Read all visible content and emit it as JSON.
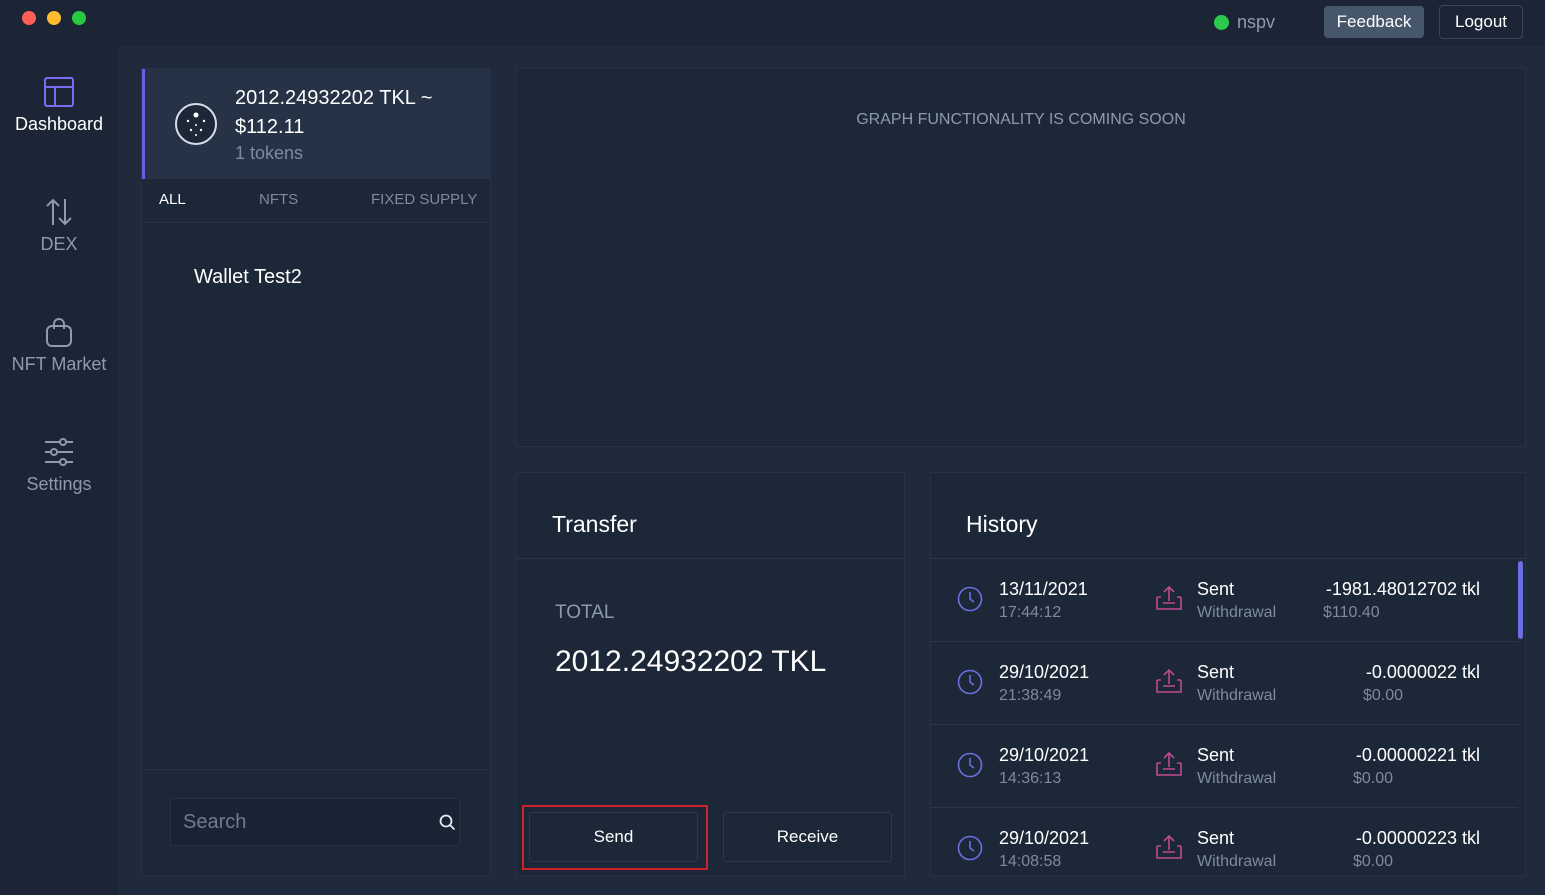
{
  "status": {
    "indicator_color": "#2bc94c",
    "label": "nspv"
  },
  "header": {
    "feedback_label": "Feedback",
    "logout_label": "Logout"
  },
  "sidebar": {
    "items": [
      {
        "label": "Dashboard",
        "icon": "dashboard-icon",
        "active": true
      },
      {
        "label": "DEX",
        "icon": "swap-arrows-icon",
        "active": false
      },
      {
        "label": "NFT Market",
        "icon": "shopping-bag-icon",
        "active": false
      },
      {
        "label": "Settings",
        "icon": "sliders-icon",
        "active": false
      }
    ]
  },
  "wallet": {
    "token_amount": "2012.24932202 TKL ~ $112.11",
    "token_count": "1 tokens",
    "tabs": [
      "ALL",
      "NFTS",
      "FIXED SUPPLY"
    ],
    "active_tab": "ALL",
    "wallet_name": "Wallet Test2",
    "search_placeholder": "Search"
  },
  "graph": {
    "message": "GRAPH FUNCTIONALITY IS COMING SOON"
  },
  "transfer": {
    "title": "Transfer",
    "total_label": "TOTAL",
    "total_value": "2012.24932202 TKL",
    "send_label": "Send",
    "receive_label": "Receive",
    "highlight_color": "#d0202a"
  },
  "history": {
    "title": "History",
    "rows": [
      {
        "date": "13/11/2021",
        "time": "17:44:12",
        "type": "Sent",
        "sub": "Withdrawal",
        "amount": "-1981.48012702 tkl",
        "usd": "$110.40"
      },
      {
        "date": "29/10/2021",
        "time": "21:38:49",
        "type": "Sent",
        "sub": "Withdrawal",
        "amount": "-0.0000022 tkl",
        "usd": "$0.00"
      },
      {
        "date": "29/10/2021",
        "time": "14:36:13",
        "type": "Sent",
        "sub": "Withdrawal",
        "amount": "-0.00000221 tkl",
        "usd": "$0.00"
      },
      {
        "date": "29/10/2021",
        "time": "14:08:58",
        "type": "Sent",
        "sub": "Withdrawal",
        "amount": "-0.00000223 tkl",
        "usd": "$0.00"
      }
    ],
    "accent_color": "#6b6fe0",
    "sent_icon_color": "#c04a8f"
  }
}
